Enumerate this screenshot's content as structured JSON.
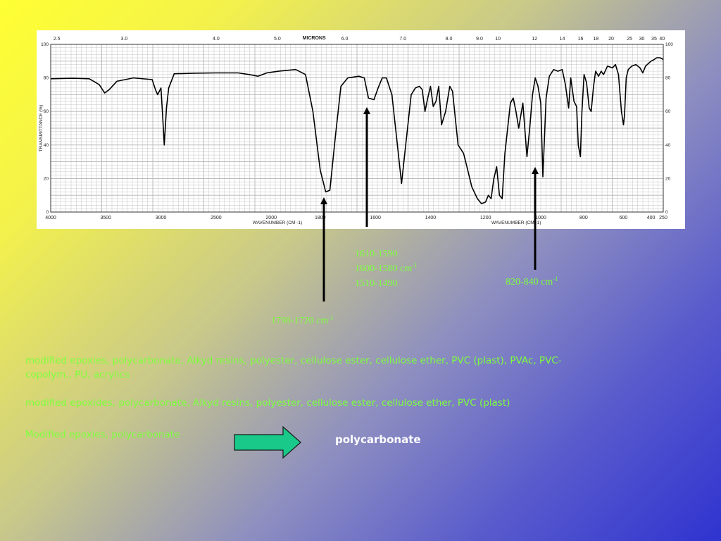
{
  "chart_data": {
    "type": "line",
    "title": "",
    "xlabel": "WAVENUMBER (CM -1)",
    "ylabel": "TRANSMITTANCE (%)",
    "top_axis_label": "MICRONS",
    "xlim": [
      4000,
      250
    ],
    "ylim": [
      0,
      100
    ],
    "grid": true,
    "x_ticks": [
      "4000",
      "3500",
      "3000",
      "2500",
      "2000",
      "1800",
      "1600",
      "1400",
      "1200",
      "1000",
      "800",
      "600",
      "400",
      "250"
    ],
    "x_ticks_mid": [
      "1200",
      "1000"
    ],
    "top_ticks": [
      "2.5",
      "3.0",
      "4.0",
      "5.0",
      "6.0",
      "7.0",
      "8.0",
      "9.0",
      "10",
      "12",
      "14",
      "16",
      "18",
      "20",
      "25",
      "30",
      "35",
      "40"
    ],
    "y_ticks": [
      "0",
      "20",
      "40",
      "60",
      "80",
      "100"
    ],
    "y_ticks_right": [
      "0",
      "20",
      "40",
      "60",
      "80",
      "100"
    ],
    "series": [
      {
        "color": "#000000",
        "points": [
          [
            4000,
            79.5
          ],
          [
            3800,
            79.8
          ],
          [
            3650,
            79.5
          ],
          [
            3560,
            76
          ],
          [
            3510,
            71
          ],
          [
            3470,
            73
          ],
          [
            3400,
            78
          ],
          [
            3250,
            80
          ],
          [
            3080,
            79
          ],
          [
            3050,
            73
          ],
          [
            3030,
            70
          ],
          [
            3000,
            74
          ],
          [
            2985,
            58
          ],
          [
            2970,
            40
          ],
          [
            2950,
            62
          ],
          [
            2930,
            74
          ],
          [
            2880,
            82.5
          ],
          [
            2700,
            82.8
          ],
          [
            2500,
            83
          ],
          [
            2300,
            83
          ],
          [
            2200,
            82
          ],
          [
            2120,
            81
          ],
          [
            2040,
            83
          ],
          [
            1970,
            84
          ],
          [
            1900,
            85
          ],
          [
            1860,
            82
          ],
          [
            1830,
            60
          ],
          [
            1800,
            25
          ],
          [
            1780,
            12
          ],
          [
            1765,
            13
          ],
          [
            1745,
            45
          ],
          [
            1725,
            75
          ],
          [
            1700,
            80
          ],
          [
            1660,
            81
          ],
          [
            1640,
            80
          ],
          [
            1625,
            68
          ],
          [
            1605,
            67
          ],
          [
            1590,
            74
          ],
          [
            1575,
            80
          ],
          [
            1560,
            80
          ],
          [
            1540,
            70
          ],
          [
            1520,
            40
          ],
          [
            1505,
            17
          ],
          [
            1490,
            40
          ],
          [
            1470,
            70
          ],
          [
            1455,
            74
          ],
          [
            1440,
            75
          ],
          [
            1430,
            73
          ],
          [
            1420,
            60
          ],
          [
            1410,
            68
          ],
          [
            1400,
            75
          ],
          [
            1390,
            63
          ],
          [
            1380,
            66
          ],
          [
            1370,
            75
          ],
          [
            1360,
            52
          ],
          [
            1345,
            60
          ],
          [
            1330,
            75
          ],
          [
            1320,
            72
          ],
          [
            1300,
            40
          ],
          [
            1280,
            35
          ],
          [
            1265,
            25
          ],
          [
            1250,
            15
          ],
          [
            1230,
            8
          ],
          [
            1215,
            5
          ],
          [
            1200,
            6
          ],
          [
            1190,
            10
          ],
          [
            1180,
            8
          ],
          [
            1170,
            20
          ],
          [
            1160,
            27
          ],
          [
            1150,
            10
          ],
          [
            1140,
            8
          ],
          [
            1130,
            35
          ],
          [
            1120,
            50
          ],
          [
            1110,
            65
          ],
          [
            1100,
            68
          ],
          [
            1090,
            60
          ],
          [
            1080,
            50
          ],
          [
            1065,
            65
          ],
          [
            1050,
            33
          ],
          [
            1040,
            50
          ],
          [
            1030,
            70
          ],
          [
            1020,
            80
          ],
          [
            1010,
            75
          ],
          [
            1000,
            65
          ],
          [
            990,
            21
          ],
          [
            975,
            68
          ],
          [
            960,
            81
          ],
          [
            940,
            85
          ],
          [
            920,
            84
          ],
          [
            900,
            85
          ],
          [
            885,
            76
          ],
          [
            870,
            62
          ],
          [
            860,
            80
          ],
          [
            845,
            66
          ],
          [
            833,
            63
          ],
          [
            825,
            40
          ],
          [
            815,
            33
          ],
          [
            808,
            60
          ],
          [
            798,
            82
          ],
          [
            785,
            77
          ],
          [
            772,
            62
          ],
          [
            762,
            60
          ],
          [
            750,
            75
          ],
          [
            740,
            84
          ],
          [
            725,
            81
          ],
          [
            712,
            84
          ],
          [
            700,
            82
          ],
          [
            680,
            87
          ],
          [
            655,
            86
          ],
          [
            640,
            88
          ],
          [
            625,
            82
          ],
          [
            610,
            60
          ],
          [
            600,
            52
          ],
          [
            592,
            58
          ],
          [
            580,
            80
          ],
          [
            565,
            85
          ],
          [
            540,
            87
          ],
          [
            510,
            88
          ],
          [
            480,
            86
          ],
          [
            460,
            83
          ],
          [
            440,
            87
          ],
          [
            400,
            90
          ],
          [
            360,
            91
          ],
          [
            330,
            92
          ],
          [
            290,
            92
          ],
          [
            250,
            91
          ]
        ]
      }
    ]
  },
  "annotations": {
    "peak_1790": {
      "main": "1790-1720 cm",
      "sup": "-1"
    },
    "peak_1600": {
      "line1": "1610-1590",
      "line2_main": "1600-1580 cm",
      "line2_sup": "-1",
      "line3": "1510-1490"
    },
    "peak_830": {
      "main": "820-840 cm",
      "sup": "-1"
    }
  },
  "candidates": {
    "line1": "modified epoxies, polycarbonate, Alkyd resins, polyester, cellulose ester, cellulose ether, PVC (plast), PVAc, PVC-copolym., PU, acrylics",
    "line2": "modified epoxides, polycarbonate, Alkyd resins, polyester, cellulose ester, cellulose ether, PVC (plast)",
    "line3": "Modified epoxies, polycarbonate"
  },
  "result": {
    "label": "polycarbonate"
  },
  "colors": {
    "annotation_text": "#7dff3d",
    "result_arrow_fill": "#19c98a",
    "result_text": "#ffffff"
  }
}
